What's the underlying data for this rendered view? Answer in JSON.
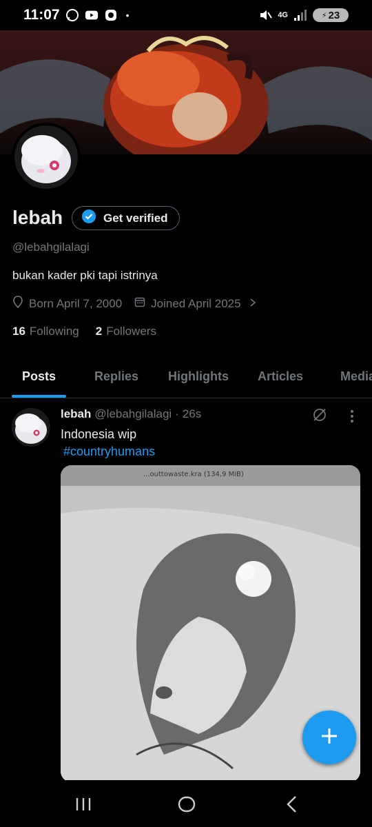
{
  "status_bar": {
    "time": "11:07",
    "network": "4G",
    "battery": "23"
  },
  "profile": {
    "name": "lebah",
    "verify_label": "Get verified",
    "handle": "@lebahgilalagi",
    "bio": "bukan kader pki tapi istrinya",
    "born": "Born April 7, 2000",
    "joined": "Joined April 2025",
    "following_count": "16",
    "following_label": "Following",
    "followers_count": "2",
    "followers_label": "Followers"
  },
  "tabs": [
    {
      "label": "Posts",
      "active": true
    },
    {
      "label": "Replies"
    },
    {
      "label": "Highlights"
    },
    {
      "label": "Articles"
    },
    {
      "label": "Media"
    }
  ],
  "post": {
    "author": "lebah",
    "handle": "@lebahgilalagi",
    "separator": "·",
    "time": "26s",
    "text": "Indonesia wip",
    "hashtag": "#countryhumans",
    "media_caption": "...outtowaste.kra (134,9 MiB)"
  },
  "colors": {
    "accent": "#1d9bf0",
    "text": "#e7e9ea",
    "muted": "#71767b",
    "border": "#2f3336"
  },
  "icons": [
    "whatsapp-icon",
    "youtube-icon",
    "app-icon",
    "mute-icon",
    "signal-icon",
    "verified-badge-icon",
    "location-icon",
    "calendar-icon",
    "chevron-right-icon",
    "grok-icon",
    "more-icon",
    "plus-icon",
    "recents-icon",
    "home-icon",
    "back-icon"
  ]
}
